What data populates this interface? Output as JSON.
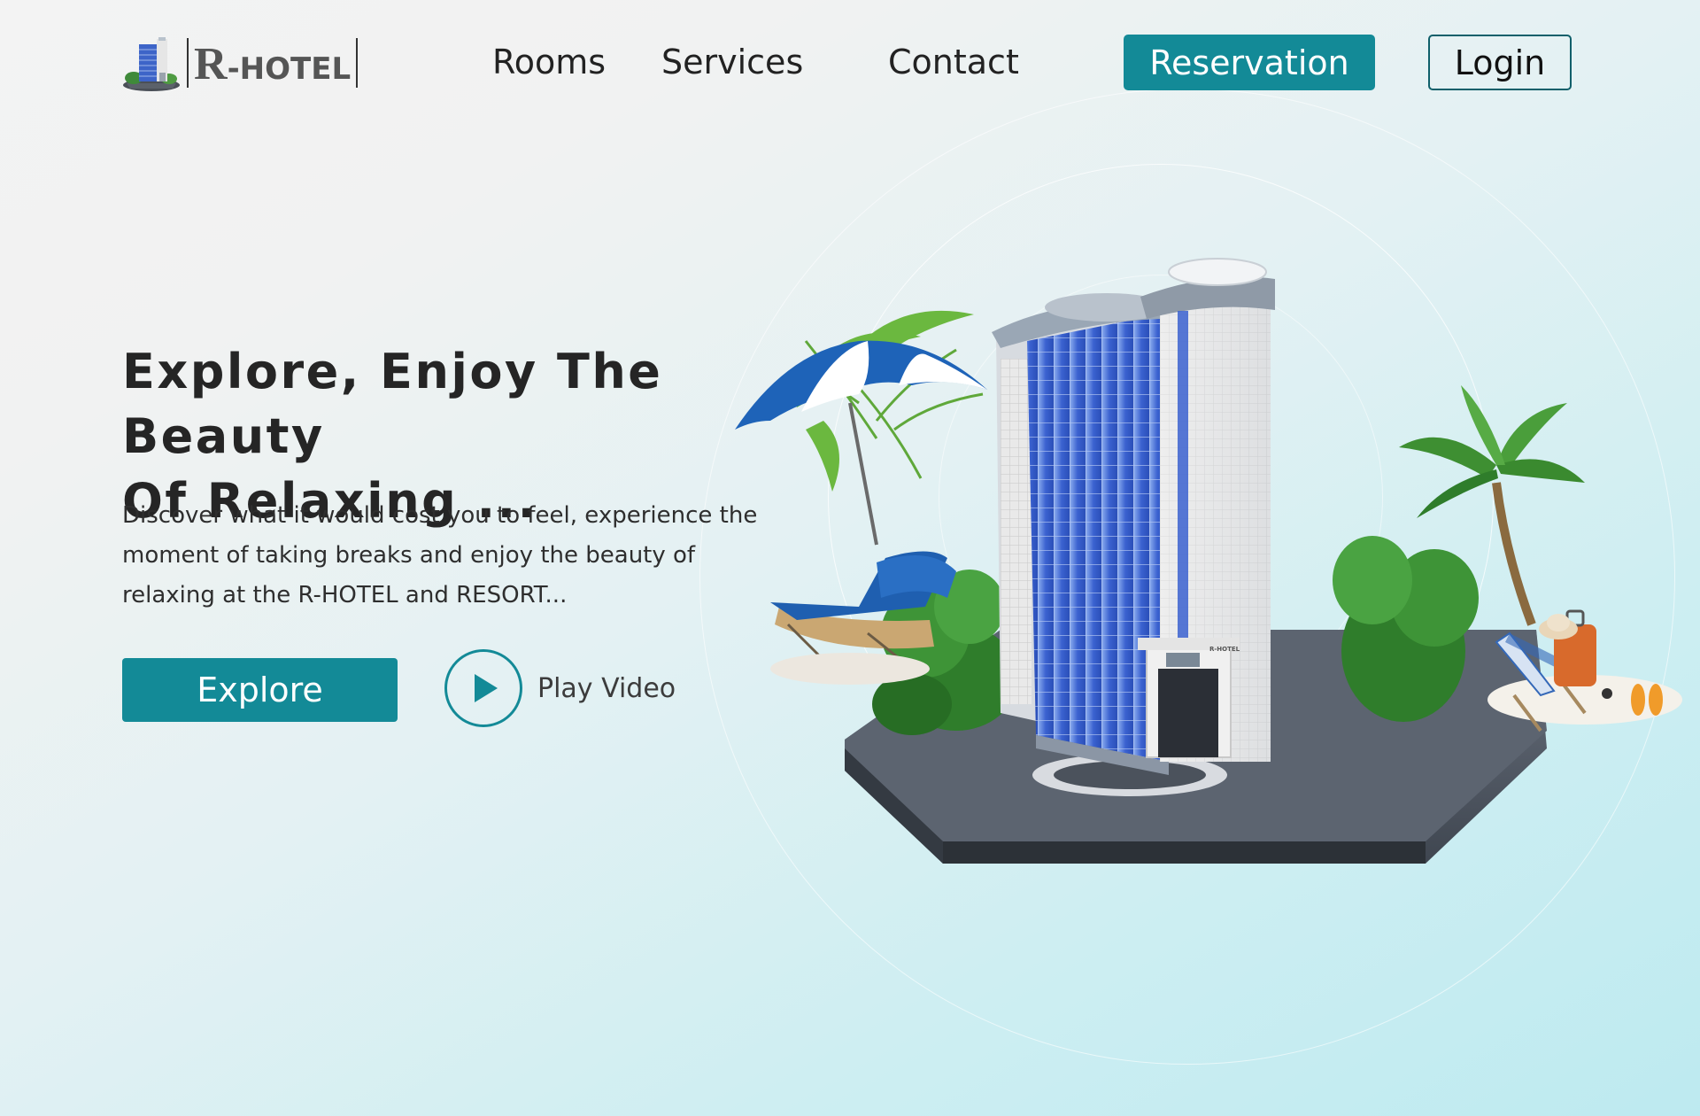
{
  "brand": {
    "logo_initial": "R",
    "logo_rest": "-HOTEL"
  },
  "nav": {
    "items": [
      {
        "label": "Rooms"
      },
      {
        "label": "Services"
      },
      {
        "label": "Contact"
      }
    ],
    "reservation_label": "Reservation",
    "login_label": "Login"
  },
  "hero": {
    "title_line1": "Explore, Enjoy The Beauty",
    "title_line2": "Of Relaxing ...",
    "description_line1": "Discover what it would cost you to feel, experience the",
    "description_line2": "moment of taking breaks and enjoy the beauty of",
    "description_line3": "relaxing at the R-HOTEL and RESORT...",
    "explore_label": "Explore",
    "play_label": "Play Video",
    "building_sign": "R-HOTEL"
  },
  "colors": {
    "accent": "#138a97",
    "text_dark": "#222222",
    "background_start": "#f3f3f3",
    "background_end": "#bdeaf0"
  },
  "icons": {
    "logo": "hotel-building-icon",
    "play": "play-icon"
  }
}
